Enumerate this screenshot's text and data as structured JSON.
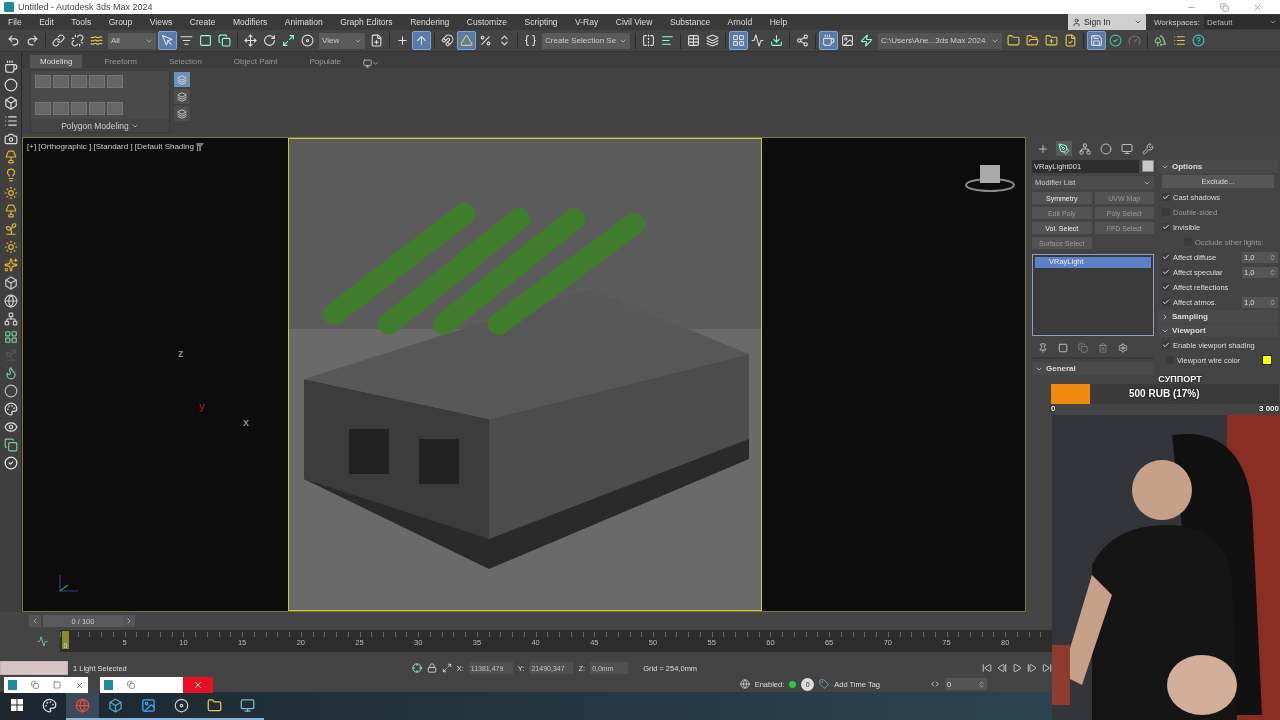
{
  "window": {
    "title": "Untitled - Autodesk 3ds Max 2024"
  },
  "menu": [
    "File",
    "Edit",
    "Tools",
    "Group",
    "Views",
    "Create",
    "Modifiers",
    "Animation",
    "Graph Editors",
    "Rendering",
    "Customize",
    "Scripting",
    "V-Ray",
    "Civil View",
    "Substance",
    "Arnold",
    "Help"
  ],
  "account": {
    "sign_in": "Sign In",
    "workspaces_label": "Workspaces:",
    "workspace": "Default"
  },
  "toolbar": {
    "selection_filter": "All",
    "coordinate_system": "View",
    "named_selection": "Create Selection Se",
    "project_path": "C:\\Users\\Ane...3ds Max 2024",
    "tools": [
      {
        "active": false
      },
      {
        "active": false
      },
      {
        "active": false
      },
      {
        "active": false
      },
      {
        "active": false
      },
      {
        "active": true
      },
      {
        "active": false
      },
      {
        "active": false
      },
      {
        "active": false
      },
      {
        "active": false
      },
      {
        "active": false
      },
      {
        "active": false
      },
      {
        "active": false
      },
      {
        "active": false
      },
      {
        "active": false
      },
      {
        "active": true
      },
      {
        "active": false
      },
      {
        "active": true
      },
      {
        "active": false
      },
      {
        "active": false
      },
      {
        "active": false
      },
      {
        "active": false
      },
      {
        "active": false
      },
      {
        "active": false
      },
      {
        "active": false
      },
      {
        "active": true
      },
      {
        "active": false
      },
      {
        "active": false
      },
      {
        "active": false
      },
      {
        "active": true
      },
      {
        "active": false
      },
      {
        "active": false
      },
      {
        "active": false
      },
      {
        "active": false
      },
      {
        "active": false
      },
      {
        "active": false
      },
      {
        "active": true
      },
      {
        "active": false
      },
      {
        "active": false
      },
      {
        "active": false
      },
      {
        "active": false
      },
      {
        "active": false
      }
    ]
  },
  "ribbon": {
    "tabs": [
      {
        "label": "Modeling",
        "selected": true
      },
      {
        "label": "Freeform",
        "selected": false
      },
      {
        "label": "Selection",
        "selected": false
      },
      {
        "label": "Object Paint",
        "selected": false
      },
      {
        "label": "Populate",
        "selected": false
      }
    ],
    "panel_label": "Polygon Modeling",
    "side_tools": [
      {
        "active": true
      },
      {
        "active": false
      },
      {
        "active": false
      }
    ]
  },
  "viewport": {
    "label": "[+] [Orthographic ] [Standard ] [Default Shading ]",
    "axis_marks": [
      {
        "label": "z",
        "color": "#8a8a8a"
      },
      {
        "label": "y",
        "color": "#8b1c1c"
      },
      {
        "label": "x",
        "color": "#8a8a8a"
      }
    ]
  },
  "command_panel": {
    "tabs": [
      {
        "selected": false
      },
      {
        "selected": true
      },
      {
        "selected": false
      },
      {
        "selected": false
      },
      {
        "selected": false
      },
      {
        "selected": false
      }
    ],
    "object_name": "VRayLight001",
    "modifier_list": "Modifier List",
    "modifier_buttons": [
      {
        "label": "Symmetry",
        "disabled": false
      },
      {
        "label": "UVW Map",
        "disabled": true
      },
      {
        "label": "Edit Poly",
        "disabled": true
      },
      {
        "label": "Poly Select",
        "disabled": true
      },
      {
        "label": "Vol. Select",
        "disabled": false
      },
      {
        "label": "FFD Select",
        "disabled": true
      },
      {
        "label": "Surface Select",
        "disabled": true
      }
    ],
    "stack": [
      {
        "label": "VRayLight",
        "selected": true
      }
    ],
    "general_rollout": {
      "title": "General",
      "expanded": true
    },
    "rollouts": [
      {
        "title": "Options",
        "expanded": true,
        "rows": [
          {
            "kind": "button",
            "label": "Exclude..."
          },
          {
            "kind": "check",
            "label": "Cast shadows",
            "checked": true,
            "disabled": false
          },
          {
            "kind": "check",
            "label": "Double-sided",
            "checked": false,
            "disabled": true
          },
          {
            "kind": "check",
            "label": "Invisible",
            "checked": true,
            "disabled": false
          },
          {
            "kind": "subcheck",
            "label": "Occlude other lights:",
            "checked": false,
            "disabled": true
          },
          {
            "kind": "spinner",
            "label": "Affect diffuse",
            "checked": true,
            "disabled": false,
            "value": "1,0"
          },
          {
            "kind": "spinner",
            "label": "Affect specular",
            "checked": true,
            "disabled": false,
            "value": "1,0"
          },
          {
            "kind": "check",
            "label": "Affect reflections",
            "checked": true,
            "disabled": false
          },
          {
            "kind": "spinner",
            "label": "Affect atmos.",
            "checked": true,
            "disabled": false,
            "value": "1,0"
          }
        ]
      },
      {
        "title": "Sampling",
        "expanded": false
      },
      {
        "title": "Viewport",
        "expanded": true,
        "rows": [
          {
            "kind": "check",
            "label": "Enable viewport shading",
            "checked": true,
            "disabled": false
          },
          {
            "kind": "swatch",
            "label": "Viewport wire color",
            "checked": false,
            "disabled": false,
            "color": "#ffff00"
          }
        ]
      }
    ]
  },
  "donation": {
    "title": "СУППОРТ",
    "amount": "500 RUB (17%)",
    "level": 0.17,
    "min": "0",
    "max": "3 000"
  },
  "timeline": {
    "range": "0 / 100",
    "level": 0,
    "current_frame": "0",
    "ticks": [
      "5",
      "10",
      "15",
      "20",
      "25",
      "30",
      "35",
      "40",
      "45",
      "50",
      "55",
      "60",
      "65",
      "70",
      "75",
      "80"
    ]
  },
  "status": {
    "selection": "1 Light Selected",
    "coords": [
      {
        "label": "X:",
        "value": "11381,479"
      },
      {
        "label": "Y:",
        "value": "21490,347"
      },
      {
        "label": "Z:",
        "value": "0,0mm"
      }
    ],
    "grid": "Grid = 254,0mm",
    "enabled_label": "Enabled:",
    "enabled": true,
    "time_tag_count": "0",
    "time_tag": "Add Time Tag",
    "frame": "0"
  },
  "taskbar": [
    {
      "running": false,
      "active": false
    },
    {
      "running": true,
      "active": true
    },
    {
      "running": true,
      "active": false
    },
    {
      "running": true,
      "active": false
    },
    {
      "running": true,
      "active": false
    },
    {
      "running": true,
      "active": false
    },
    {
      "running": true,
      "active": false
    }
  ]
}
